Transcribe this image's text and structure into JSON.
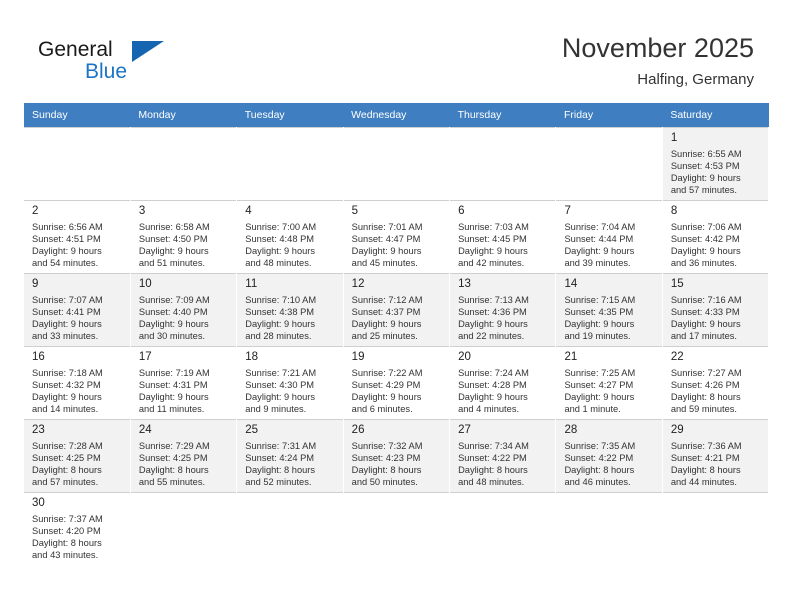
{
  "brand": {
    "name_part1": "General",
    "name_part2": "Blue",
    "triangle_color": "#1565b0",
    "blue_color": "#1c74c4"
  },
  "header": {
    "title": "November 2025",
    "subtitle": "Halfing, Germany"
  },
  "theme": {
    "header_row_bg": "#3f7fc1",
    "header_row_text": "#ffffff",
    "shaded_row_bg": "#f2f2f2",
    "grid_line": "#cfcfcf"
  },
  "weekday_headers": [
    "Sunday",
    "Monday",
    "Tuesday",
    "Wednesday",
    "Thursday",
    "Friday",
    "Saturday"
  ],
  "weeks": [
    [
      {
        "day": "",
        "sunrise": "",
        "sunset": "",
        "daylight1": "",
        "daylight2": "",
        "empty": true
      },
      {
        "day": "",
        "sunrise": "",
        "sunset": "",
        "daylight1": "",
        "daylight2": "",
        "empty": true
      },
      {
        "day": "",
        "sunrise": "",
        "sunset": "",
        "daylight1": "",
        "daylight2": "",
        "empty": true
      },
      {
        "day": "",
        "sunrise": "",
        "sunset": "",
        "daylight1": "",
        "daylight2": "",
        "empty": true
      },
      {
        "day": "",
        "sunrise": "",
        "sunset": "",
        "daylight1": "",
        "daylight2": "",
        "empty": true
      },
      {
        "day": "",
        "sunrise": "",
        "sunset": "",
        "daylight1": "",
        "daylight2": "",
        "empty": true
      },
      {
        "day": "1",
        "sunrise": "Sunrise: 6:55 AM",
        "sunset": "Sunset: 4:53 PM",
        "daylight1": "Daylight: 9 hours",
        "daylight2": "and 57 minutes.",
        "empty": false
      }
    ],
    [
      {
        "day": "2",
        "sunrise": "Sunrise: 6:56 AM",
        "sunset": "Sunset: 4:51 PM",
        "daylight1": "Daylight: 9 hours",
        "daylight2": "and 54 minutes.",
        "empty": false
      },
      {
        "day": "3",
        "sunrise": "Sunrise: 6:58 AM",
        "sunset": "Sunset: 4:50 PM",
        "daylight1": "Daylight: 9 hours",
        "daylight2": "and 51 minutes.",
        "empty": false
      },
      {
        "day": "4",
        "sunrise": "Sunrise: 7:00 AM",
        "sunset": "Sunset: 4:48 PM",
        "daylight1": "Daylight: 9 hours",
        "daylight2": "and 48 minutes.",
        "empty": false
      },
      {
        "day": "5",
        "sunrise": "Sunrise: 7:01 AM",
        "sunset": "Sunset: 4:47 PM",
        "daylight1": "Daylight: 9 hours",
        "daylight2": "and 45 minutes.",
        "empty": false
      },
      {
        "day": "6",
        "sunrise": "Sunrise: 7:03 AM",
        "sunset": "Sunset: 4:45 PM",
        "daylight1": "Daylight: 9 hours",
        "daylight2": "and 42 minutes.",
        "empty": false
      },
      {
        "day": "7",
        "sunrise": "Sunrise: 7:04 AM",
        "sunset": "Sunset: 4:44 PM",
        "daylight1": "Daylight: 9 hours",
        "daylight2": "and 39 minutes.",
        "empty": false
      },
      {
        "day": "8",
        "sunrise": "Sunrise: 7:06 AM",
        "sunset": "Sunset: 4:42 PM",
        "daylight1": "Daylight: 9 hours",
        "daylight2": "and 36 minutes.",
        "empty": false
      }
    ],
    [
      {
        "day": "9",
        "sunrise": "Sunrise: 7:07 AM",
        "sunset": "Sunset: 4:41 PM",
        "daylight1": "Daylight: 9 hours",
        "daylight2": "and 33 minutes.",
        "empty": false
      },
      {
        "day": "10",
        "sunrise": "Sunrise: 7:09 AM",
        "sunset": "Sunset: 4:40 PM",
        "daylight1": "Daylight: 9 hours",
        "daylight2": "and 30 minutes.",
        "empty": false
      },
      {
        "day": "11",
        "sunrise": "Sunrise: 7:10 AM",
        "sunset": "Sunset: 4:38 PM",
        "daylight1": "Daylight: 9 hours",
        "daylight2": "and 28 minutes.",
        "empty": false
      },
      {
        "day": "12",
        "sunrise": "Sunrise: 7:12 AM",
        "sunset": "Sunset: 4:37 PM",
        "daylight1": "Daylight: 9 hours",
        "daylight2": "and 25 minutes.",
        "empty": false
      },
      {
        "day": "13",
        "sunrise": "Sunrise: 7:13 AM",
        "sunset": "Sunset: 4:36 PM",
        "daylight1": "Daylight: 9 hours",
        "daylight2": "and 22 minutes.",
        "empty": false
      },
      {
        "day": "14",
        "sunrise": "Sunrise: 7:15 AM",
        "sunset": "Sunset: 4:35 PM",
        "daylight1": "Daylight: 9 hours",
        "daylight2": "and 19 minutes.",
        "empty": false
      },
      {
        "day": "15",
        "sunrise": "Sunrise: 7:16 AM",
        "sunset": "Sunset: 4:33 PM",
        "daylight1": "Daylight: 9 hours",
        "daylight2": "and 17 minutes.",
        "empty": false
      }
    ],
    [
      {
        "day": "16",
        "sunrise": "Sunrise: 7:18 AM",
        "sunset": "Sunset: 4:32 PM",
        "daylight1": "Daylight: 9 hours",
        "daylight2": "and 14 minutes.",
        "empty": false
      },
      {
        "day": "17",
        "sunrise": "Sunrise: 7:19 AM",
        "sunset": "Sunset: 4:31 PM",
        "daylight1": "Daylight: 9 hours",
        "daylight2": "and 11 minutes.",
        "empty": false
      },
      {
        "day": "18",
        "sunrise": "Sunrise: 7:21 AM",
        "sunset": "Sunset: 4:30 PM",
        "daylight1": "Daylight: 9 hours",
        "daylight2": "and 9 minutes.",
        "empty": false
      },
      {
        "day": "19",
        "sunrise": "Sunrise: 7:22 AM",
        "sunset": "Sunset: 4:29 PM",
        "daylight1": "Daylight: 9 hours",
        "daylight2": "and 6 minutes.",
        "empty": false
      },
      {
        "day": "20",
        "sunrise": "Sunrise: 7:24 AM",
        "sunset": "Sunset: 4:28 PM",
        "daylight1": "Daylight: 9 hours",
        "daylight2": "and 4 minutes.",
        "empty": false
      },
      {
        "day": "21",
        "sunrise": "Sunrise: 7:25 AM",
        "sunset": "Sunset: 4:27 PM",
        "daylight1": "Daylight: 9 hours",
        "daylight2": "and 1 minute.",
        "empty": false
      },
      {
        "day": "22",
        "sunrise": "Sunrise: 7:27 AM",
        "sunset": "Sunset: 4:26 PM",
        "daylight1": "Daylight: 8 hours",
        "daylight2": "and 59 minutes.",
        "empty": false
      }
    ],
    [
      {
        "day": "23",
        "sunrise": "Sunrise: 7:28 AM",
        "sunset": "Sunset: 4:25 PM",
        "daylight1": "Daylight: 8 hours",
        "daylight2": "and 57 minutes.",
        "empty": false
      },
      {
        "day": "24",
        "sunrise": "Sunrise: 7:29 AM",
        "sunset": "Sunset: 4:25 PM",
        "daylight1": "Daylight: 8 hours",
        "daylight2": "and 55 minutes.",
        "empty": false
      },
      {
        "day": "25",
        "sunrise": "Sunrise: 7:31 AM",
        "sunset": "Sunset: 4:24 PM",
        "daylight1": "Daylight: 8 hours",
        "daylight2": "and 52 minutes.",
        "empty": false
      },
      {
        "day": "26",
        "sunrise": "Sunrise: 7:32 AM",
        "sunset": "Sunset: 4:23 PM",
        "daylight1": "Daylight: 8 hours",
        "daylight2": "and 50 minutes.",
        "empty": false
      },
      {
        "day": "27",
        "sunrise": "Sunrise: 7:34 AM",
        "sunset": "Sunset: 4:22 PM",
        "daylight1": "Daylight: 8 hours",
        "daylight2": "and 48 minutes.",
        "empty": false
      },
      {
        "day": "28",
        "sunrise": "Sunrise: 7:35 AM",
        "sunset": "Sunset: 4:22 PM",
        "daylight1": "Daylight: 8 hours",
        "daylight2": "and 46 minutes.",
        "empty": false
      },
      {
        "day": "29",
        "sunrise": "Sunrise: 7:36 AM",
        "sunset": "Sunset: 4:21 PM",
        "daylight1": "Daylight: 8 hours",
        "daylight2": "and 44 minutes.",
        "empty": false
      }
    ],
    [
      {
        "day": "30",
        "sunrise": "Sunrise: 7:37 AM",
        "sunset": "Sunset: 4:20 PM",
        "daylight1": "Daylight: 8 hours",
        "daylight2": "and 43 minutes.",
        "empty": false
      },
      {
        "day": "",
        "sunrise": "",
        "sunset": "",
        "daylight1": "",
        "daylight2": "",
        "empty": true
      },
      {
        "day": "",
        "sunrise": "",
        "sunset": "",
        "daylight1": "",
        "daylight2": "",
        "empty": true
      },
      {
        "day": "",
        "sunrise": "",
        "sunset": "",
        "daylight1": "",
        "daylight2": "",
        "empty": true
      },
      {
        "day": "",
        "sunrise": "",
        "sunset": "",
        "daylight1": "",
        "daylight2": "",
        "empty": true
      },
      {
        "day": "",
        "sunrise": "",
        "sunset": "",
        "daylight1": "",
        "daylight2": "",
        "empty": true
      },
      {
        "day": "",
        "sunrise": "",
        "sunset": "",
        "daylight1": "",
        "daylight2": "",
        "empty": true
      }
    ]
  ]
}
